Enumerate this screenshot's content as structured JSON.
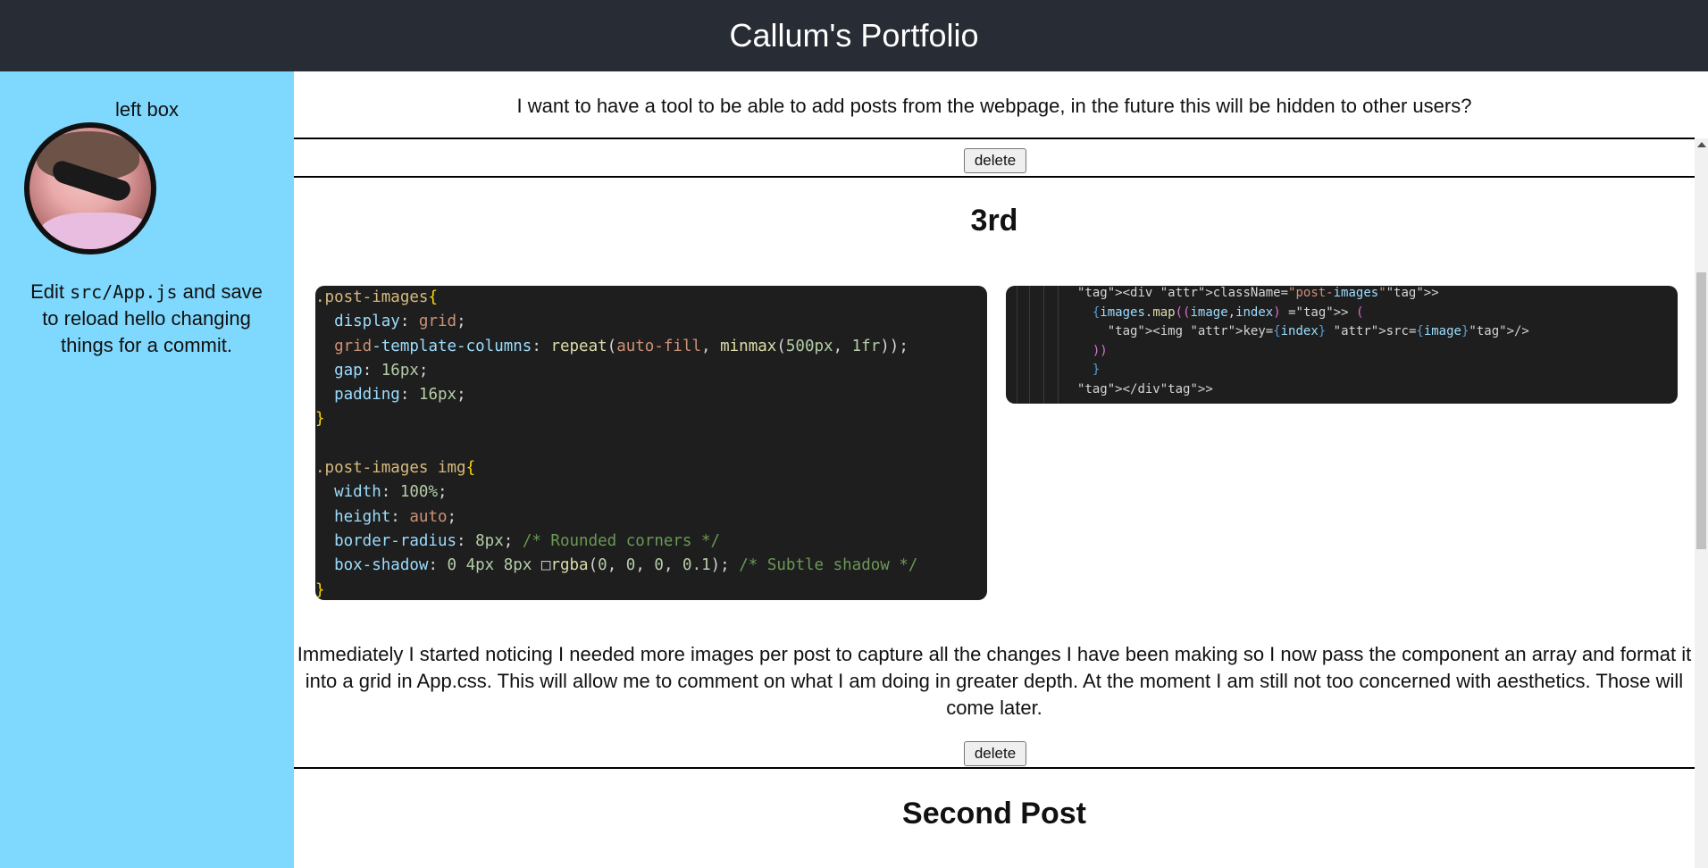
{
  "header": {
    "title": "Callum's Portfolio"
  },
  "sidebar": {
    "box_title": "left box",
    "edit_prefix": "Edit ",
    "edit_code": "src/App.js",
    "edit_suffix": " and save to reload hello changing things for a commit."
  },
  "main": {
    "top_text": "I want to have a tool to be able to add posts from the webpage, in the future this will be hidden to other users?",
    "delete_label": "delete",
    "post": {
      "title": "3rd",
      "css_code": [
        ".post-images{",
        "  display: grid;",
        "  grid-template-columns: repeat(auto-fill, minmax(500px, 1fr));",
        "  gap: 16px;",
        "  padding: 16px;",
        "}",
        "",
        ".post-images img{",
        "  width: 100%;",
        "  height: auto;",
        "  border-radius: 8px; /* Rounded corners */",
        "  box-shadow: 0 4px 8px □rgba(0, 0, 0, 0.1); /* Subtle shadow */",
        "}"
      ],
      "jsx_code": [
        "<div className=\"post-images\">",
        "  {images.map((image,index) => (",
        "    <img key={index} src={image}/>",
        "  ))",
        "  }",
        "</div>"
      ],
      "paragraph": "Immediately I started noticing I needed more images per post to capture all the changes I have been making so I now pass the component an array and format it into a grid in App.css. This will allow me to comment on what I am doing in greater depth. At the moment I am still not too concerned with aesthetics. Those will come later."
    },
    "next_post_title": "Second Post"
  }
}
